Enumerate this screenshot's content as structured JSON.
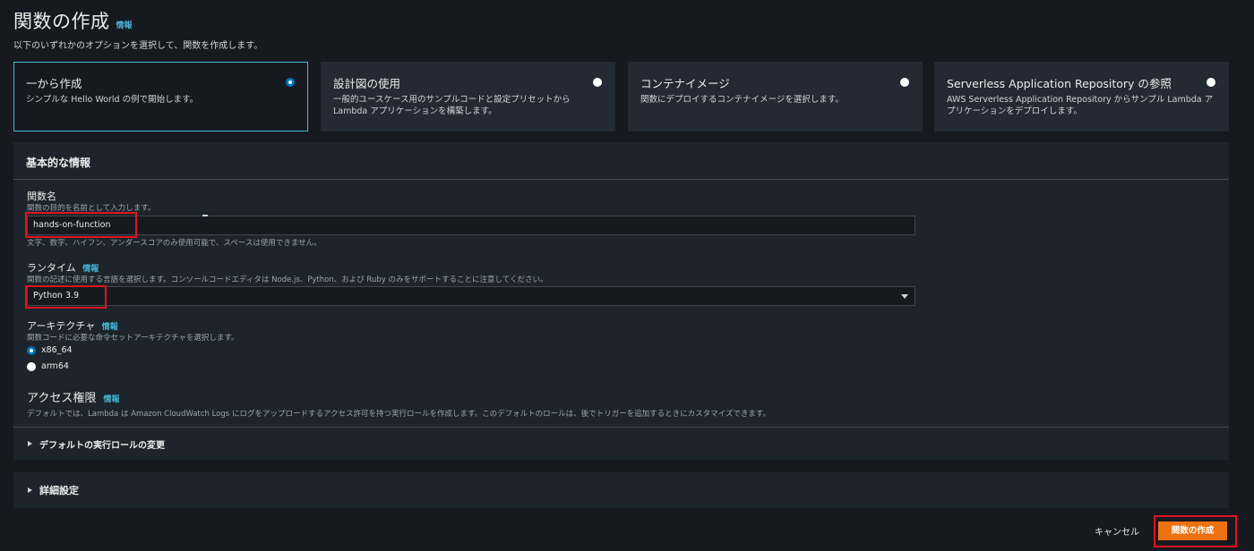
{
  "header": {
    "title": "関数の作成",
    "info": "情報",
    "subtitle": "以下のいずれかのオプションを選択して、関数を作成します。"
  },
  "options": [
    {
      "title": "一から作成",
      "desc": "シンプルな Hello World の例で開始します。",
      "selected": true
    },
    {
      "title": "設計図の使用",
      "desc": "一般的ユースケース用のサンプルコードと設定プリセットから Lambda アプリケーションを構築します。",
      "selected": false
    },
    {
      "title": "コンテナイメージ",
      "desc": "関数にデプロイするコンテナイメージを選択します。",
      "selected": false
    },
    {
      "title": "Serverless Application Repository の参照",
      "desc": "AWS Serverless Application Repository からサンプル Lambda アプリケーションをデプロイします。",
      "selected": false
    }
  ],
  "basic": {
    "header": "基本的な情報",
    "function_name": {
      "label": "関数名",
      "hint": "関数の目的を名前として入力します。",
      "value": "hands-on-function",
      "constraint": "文字、数字、ハイフン、アンダースコアのみ使用可能で、スペースは使用できません。"
    },
    "runtime": {
      "label": "ランタイム",
      "info": "情報",
      "hint": "関数の記述に使用する言語を選択します。コンソールコードエディタは Node.js、Python、および Ruby のみをサポートすることに注意してください。",
      "value": "Python 3.9"
    },
    "architecture": {
      "label": "アーキテクチャ",
      "info": "情報",
      "hint": "関数コードに必要な命令セットアーキテクチャを選択します。",
      "options": [
        "x86_64",
        "arm64"
      ],
      "selected": "x86_64"
    },
    "permissions": {
      "label": "アクセス権限",
      "info": "情報",
      "hint": "デフォルトでは、Lambda は Amazon CloudWatch Logs にログをアップロードするアクセス許可を持つ実行ロールを作成します。このデフォルトのロールは、後でトリガーを追加するときにカスタマイズできます。",
      "expander": "デフォルトの実行ロールの変更"
    }
  },
  "advanced": {
    "label": "詳細設定"
  },
  "footer": {
    "cancel": "キャンセル",
    "create": "関数の作成"
  },
  "colors": {
    "accent": "#44b9d6",
    "primary_button": "#ec7211",
    "highlight": "#e0141e",
    "radio_selected": "#0073bb"
  }
}
